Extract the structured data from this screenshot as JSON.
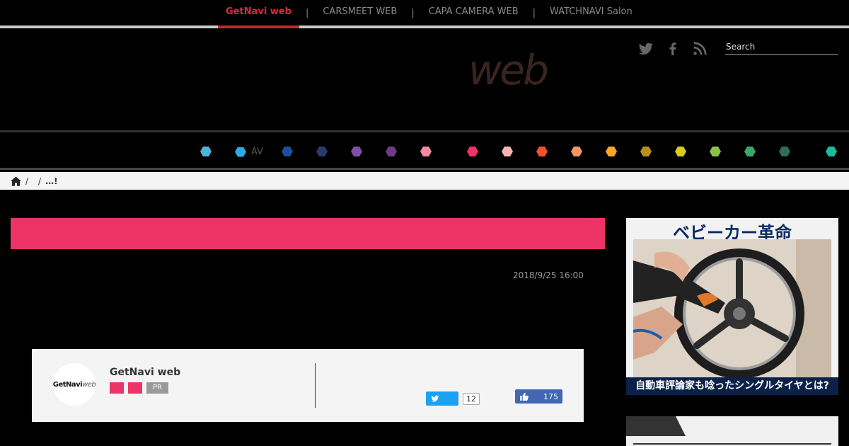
{
  "network": {
    "links": [
      "GetNavi web",
      "CARSMEET WEB",
      "CAPA CAMERA WEB",
      "WATCHNAVI Salon"
    ],
    "separator": "|"
  },
  "header": {
    "logo_text": "web",
    "search_placeholder": "Search"
  },
  "social_icons": [
    "twitter-icon",
    "facebook-icon",
    "rss-icon"
  ],
  "categories": [
    {
      "color": "#4fb3d9",
      "label": ""
    },
    {
      "color": "#29abe2",
      "label": "AV"
    },
    {
      "color": "#1f4e9a",
      "label": ""
    },
    {
      "color": "#2b3a6b",
      "label": ""
    },
    {
      "color": "#7e4fa8",
      "label": ""
    },
    {
      "color": "#6e3a8a",
      "label": ""
    },
    {
      "color": "#f08ca0",
      "label": ""
    },
    {
      "color": "#ee3366",
      "label": ""
    },
    {
      "color": "#f7b5b0",
      "label": ""
    },
    {
      "color": "#f0532b",
      "label": ""
    },
    {
      "color": "#f2956b",
      "label": ""
    },
    {
      "color": "#f9a825",
      "label": ""
    },
    {
      "color": "#b59020",
      "label": ""
    },
    {
      "color": "#d9cc1a",
      "label": ""
    },
    {
      "color": "#8bc34a",
      "label": ""
    },
    {
      "color": "#3aa86b",
      "label": ""
    },
    {
      "color": "#2e6e55",
      "label": ""
    },
    {
      "color": "#1abc9c",
      "label": ""
    }
  ],
  "breadcrumb": {
    "sep1": "/",
    "sep2": "/",
    "current": "…!"
  },
  "article": {
    "date": "2018/9/25 16:00",
    "accent_color": "#ee3366"
  },
  "author": {
    "avatar_text": "GetNavi",
    "avatar_text_web": "web",
    "name": "GetNavi web",
    "tag_pr": "PR",
    "twitter_count": "12",
    "facebook_count": "175"
  },
  "ad": {
    "title": "ベビーカー革命",
    "caption": "自動車評論家も唸ったシングルタイヤとは?"
  }
}
